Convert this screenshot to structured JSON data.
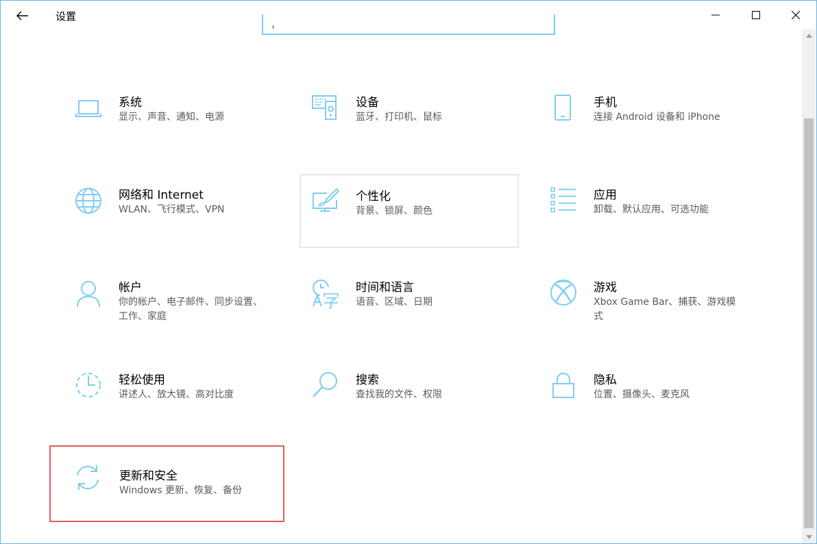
{
  "window": {
    "title": "设置"
  },
  "colors": {
    "accent": "#7ecdf2",
    "selected_border": "#e05b5b",
    "hover_border": "#e6e6e6"
  },
  "tiles": [
    {
      "title": "系统",
      "desc": "显示、声音、通知、电源",
      "icon": "laptop-icon"
    },
    {
      "title": "设备",
      "desc": "蓝牙、打印机、鼠标",
      "icon": "devices-icon"
    },
    {
      "title": "手机",
      "desc": "连接 Android 设备和 iPhone",
      "icon": "phone-icon"
    },
    {
      "title": "网络和 Internet",
      "desc": "WLAN、飞行模式、VPN",
      "icon": "globe-icon"
    },
    {
      "title": "个性化",
      "desc": "背景、锁屏、颜色",
      "icon": "personalization-icon"
    },
    {
      "title": "应用",
      "desc": "卸载、默认应用、可选功能",
      "icon": "apps-list-icon"
    },
    {
      "title": "帐户",
      "desc": "你的帐户、电子邮件、同步设置、工作、家庭",
      "icon": "person-icon"
    },
    {
      "title": "时间和语言",
      "desc": "语音、区域、日期",
      "icon": "time-language-icon"
    },
    {
      "title": "游戏",
      "desc": "Xbox Game Bar、捕获、游戏模式",
      "icon": "xbox-icon"
    },
    {
      "title": "轻松使用",
      "desc": "讲述人、放大镜、高对比度",
      "icon": "ease-of-access-icon"
    },
    {
      "title": "搜索",
      "desc": "查找我的文件、权限",
      "icon": "search-icon"
    },
    {
      "title": "隐私",
      "desc": "位置、摄像头、麦克风",
      "icon": "lock-icon"
    },
    {
      "title": "更新和安全",
      "desc": "Windows 更新、恢复、备份",
      "icon": "sync-icon"
    }
  ]
}
